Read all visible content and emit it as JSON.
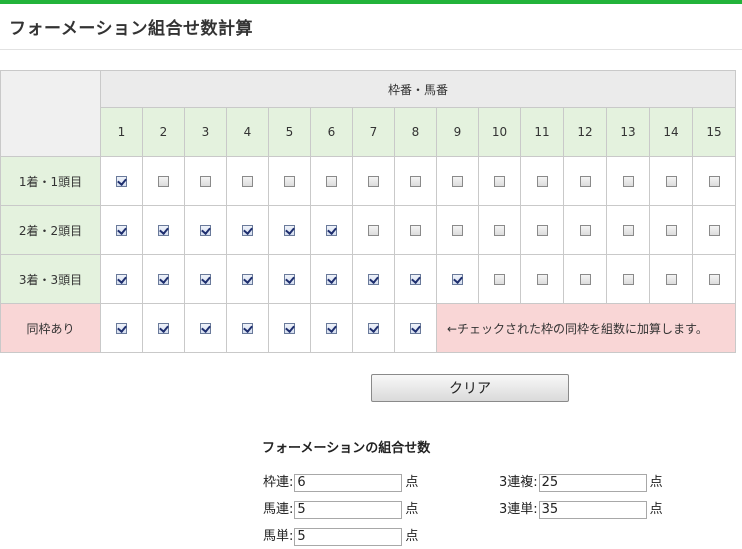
{
  "title": "フォーメーション組合せ数計算",
  "accent_color": "#22b33a",
  "table": {
    "group_header": "枠番・馬番",
    "columns": [
      "1",
      "2",
      "3",
      "4",
      "5",
      "6",
      "7",
      "8",
      "9",
      "10",
      "11",
      "12",
      "13",
      "14",
      "15"
    ],
    "rows": [
      {
        "label": "1着・1頭目",
        "checked": [
          true,
          false,
          false,
          false,
          false,
          false,
          false,
          false,
          false,
          false,
          false,
          false,
          false,
          false,
          false
        ]
      },
      {
        "label": "2着・2頭目",
        "checked": [
          true,
          true,
          true,
          true,
          true,
          true,
          false,
          false,
          false,
          false,
          false,
          false,
          false,
          false,
          false
        ]
      },
      {
        "label": "3着・3頭目",
        "checked": [
          true,
          true,
          true,
          true,
          true,
          true,
          true,
          true,
          true,
          false,
          false,
          false,
          false,
          false,
          false
        ]
      }
    ],
    "same_frame": {
      "label": "同枠あり",
      "checked": [
        true,
        true,
        true,
        true,
        true,
        true,
        true,
        true
      ],
      "note": "←チェックされた枠の同枠を組数に加算します。"
    }
  },
  "clear_button": "クリア",
  "summary": {
    "title": "フォーメーションの組合せ数",
    "unit": "点",
    "fields": {
      "wakuren": {
        "label": "枠連:",
        "value": "6"
      },
      "umaren": {
        "label": "馬連:",
        "value": "5"
      },
      "umatan": {
        "label": "馬単:",
        "value": "5"
      },
      "sanrenpuku": {
        "label": "3連複:",
        "value": "25"
      },
      "sanrentan": {
        "label": "3連単:",
        "value": "35"
      }
    }
  }
}
